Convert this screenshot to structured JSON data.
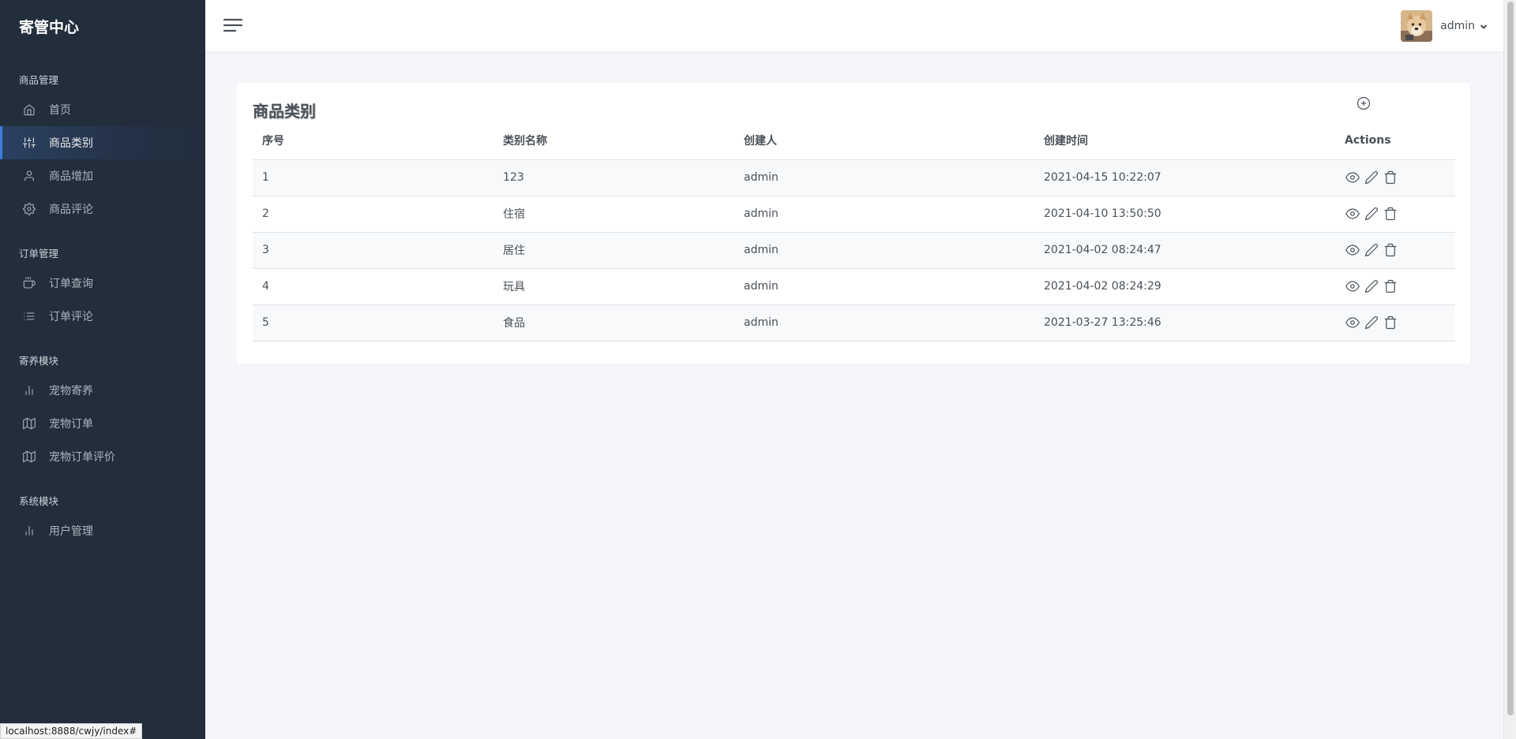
{
  "app": {
    "brand": "寄管中心"
  },
  "sidebar": {
    "sections": [
      {
        "header": "商品管理",
        "items": [
          {
            "label": "首页",
            "icon": "home-icon",
            "active": false
          },
          {
            "label": "商品类别",
            "icon": "sliders-icon",
            "active": true
          },
          {
            "label": "商品增加",
            "icon": "user-icon",
            "active": false
          },
          {
            "label": "商品评论",
            "icon": "settings-icon",
            "active": false
          }
        ]
      },
      {
        "header": "订单管理",
        "items": [
          {
            "label": "订单查询",
            "icon": "coffee-icon",
            "active": false
          },
          {
            "label": "订单评论",
            "icon": "list-icon",
            "active": false
          }
        ]
      },
      {
        "header": "寄养模块",
        "items": [
          {
            "label": "宠物寄养",
            "icon": "bar-chart-icon",
            "active": false
          },
          {
            "label": "宠物订单",
            "icon": "map-icon",
            "active": false
          },
          {
            "label": "宠物订单评价",
            "icon": "map-icon",
            "active": false
          }
        ]
      },
      {
        "header": "系统模块",
        "items": [
          {
            "label": "用户管理",
            "icon": "bar-chart-icon",
            "active": false
          }
        ]
      }
    ]
  },
  "topbar": {
    "user_name": "admin"
  },
  "card": {
    "title": "商品类别",
    "columns": [
      "序号",
      "类别名称",
      "创建人",
      "创建时间",
      "Actions"
    ],
    "rows": [
      {
        "id": "1",
        "name": "123",
        "creator": "admin",
        "created": "2021-04-15 10:22:07"
      },
      {
        "id": "2",
        "name": "住宿",
        "creator": "admin",
        "created": "2021-04-10 13:50:50"
      },
      {
        "id": "3",
        "name": "居住",
        "creator": "admin",
        "created": "2021-04-02 08:24:47"
      },
      {
        "id": "4",
        "name": "玩具",
        "creator": "admin",
        "created": "2021-04-02 08:24:29"
      },
      {
        "id": "5",
        "name": "食品",
        "creator": "admin",
        "created": "2021-03-27 13:25:46"
      }
    ]
  },
  "status_bar": {
    "url": "localhost:8888/cwjy/index#"
  },
  "colors": {
    "sidebar_bg": "#222e3c",
    "accent": "#3b7ddd",
    "page_bg": "#f5f6fa"
  }
}
